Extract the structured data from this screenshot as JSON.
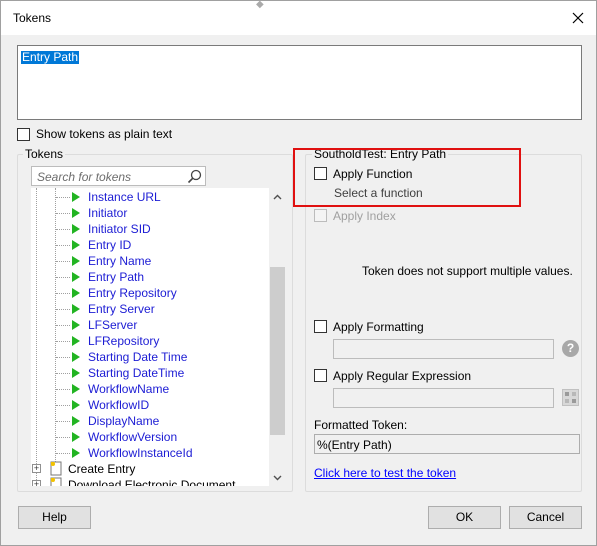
{
  "window": {
    "title": "Tokens"
  },
  "editor": {
    "selected_text": "Entry Path"
  },
  "plain_text_option": {
    "label": "Show tokens as plain text",
    "checked": false
  },
  "tokens_panel": {
    "title": "Tokens",
    "search_placeholder": "Search for tokens",
    "items": [
      "Instance URL",
      "Initiator",
      "Initiator SID",
      "Entry ID",
      "Entry Name",
      "Entry Path",
      "Entry Repository",
      "Entry Server",
      "LFServer",
      "LFRepository",
      "Starting Date Time",
      "Starting DateTime",
      "WorkflowName",
      "WorkflowID",
      "DisplayName",
      "WorkflowVersion",
      "WorkflowInstanceId"
    ],
    "folders": [
      "Create Entry",
      "Download Electronic Document"
    ]
  },
  "options_panel": {
    "title": "SoutholdTest: Entry Path",
    "apply_function": {
      "label": "Apply Function",
      "checked": false
    },
    "select_function": "Select a function",
    "apply_index": {
      "label": "Apply Index",
      "enabled": false
    },
    "multi_value_note": "Token does not support multiple values.",
    "apply_formatting": {
      "label": "Apply Formatting",
      "checked": false
    },
    "formatting_value": "",
    "help_icon": "?",
    "apply_regex": {
      "label": "Apply Regular Expression",
      "checked": false
    },
    "regex_value": "",
    "formatted_token_label": "Formatted Token:",
    "formatted_token_value": "%(Entry Path)",
    "test_link": "Click here to test the token"
  },
  "buttons": {
    "help": "Help",
    "ok": "OK",
    "cancel": "Cancel"
  },
  "colors": {
    "token_text": "#1c1cd4",
    "highlight": "#e01010",
    "selection": "#0078d7",
    "arrow": "#22b422"
  }
}
